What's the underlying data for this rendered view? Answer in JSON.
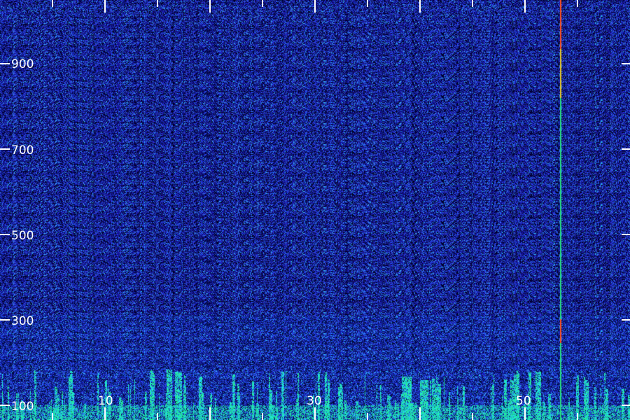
{
  "spectrogram": {
    "y_axis": {
      "tick_labels": [
        "900",
        "700",
        "500",
        "300",
        "100"
      ],
      "tick_values": [
        900,
        700,
        500,
        300,
        100
      ]
    },
    "x_axis": {
      "tick_labels": [
        "10",
        "30",
        "50"
      ],
      "tick_values": [
        10,
        30,
        50
      ]
    },
    "colors": {
      "background": "#000000",
      "noise_low": "#10108a",
      "noise_mid": "#2a3ae0",
      "signal_cyan": "#30e0e0",
      "signal_green": "#30ff80",
      "carrier_red": "#ff3a1a",
      "tick_color": "#ffffff"
    }
  }
}
